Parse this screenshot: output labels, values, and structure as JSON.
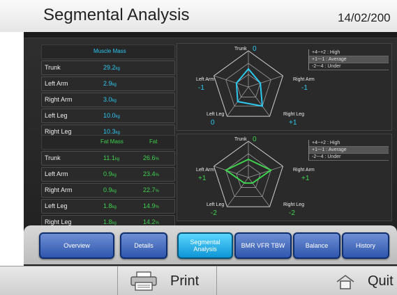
{
  "header": {
    "title": "Segmental Analysis",
    "date": "14/02/200"
  },
  "muscle": {
    "header": "Muscle Mass",
    "rows": [
      {
        "label": "Trunk",
        "value": "29.2",
        "unit": "kg"
      },
      {
        "label": "Left Arm",
        "value": "2.9",
        "unit": "kg"
      },
      {
        "label": "Right Arm",
        "value": "3.0",
        "unit": "kg"
      },
      {
        "label": "Left Leg",
        "value": "10.0",
        "unit": "kg"
      },
      {
        "label": "Right Leg",
        "value": "10.3",
        "unit": "kg"
      }
    ]
  },
  "fat": {
    "header_mass": "Fat Mass",
    "header_pct": "Fat",
    "rows": [
      {
        "label": "Trunk",
        "mass": "11.1",
        "mass_unit": "kg",
        "pct": "26.6",
        "pct_unit": "%"
      },
      {
        "label": "Left Arm",
        "mass": "0.9",
        "mass_unit": "kg",
        "pct": "23.4",
        "pct_unit": "%"
      },
      {
        "label": "Right Arm",
        "mass": "0.9",
        "mass_unit": "kg",
        "pct": "22.7",
        "pct_unit": "%"
      },
      {
        "label": "Left Leg",
        "mass": "1.8",
        "mass_unit": "kg",
        "pct": "14.9",
        "pct_unit": "%"
      },
      {
        "label": "Right Leg",
        "mass": "1.8",
        "mass_unit": "kg",
        "pct": "14.2",
        "pct_unit": "%"
      }
    ]
  },
  "legend": {
    "high": "+4~+2 : High",
    "average": "+1~-1 : Average",
    "under": "-2~-4 : Under"
  },
  "muscle_radar": {
    "labels": {
      "trunk": "Trunk",
      "right_arm": "Right Arm",
      "right_leg": "Right Leg",
      "left_leg": "Left Leg",
      "left_arm": "Left Arm"
    },
    "values": {
      "trunk": "0",
      "right_arm": "-1",
      "right_leg": "+1",
      "left_leg": "0",
      "left_arm": "-1"
    },
    "color": "#2dc8f0"
  },
  "fat_radar": {
    "labels": {
      "trunk": "Trunk",
      "right_arm": "Right Arm",
      "right_leg": "Right Leg",
      "left_leg": "Left Leg",
      "left_arm": "Left Arm"
    },
    "values": {
      "trunk": "0",
      "right_arm": "+1",
      "right_leg": "-2",
      "left_leg": "-2",
      "left_arm": "+1"
    },
    "color": "#3fd24f"
  },
  "tabs": {
    "overview": "Overview",
    "details": "Details",
    "segmental": "Segmental Analysis",
    "bmr": "BMR VFR TBW",
    "balance": "Balance",
    "history": "History"
  },
  "footer": {
    "print": "Print",
    "quit": "Quit"
  }
}
